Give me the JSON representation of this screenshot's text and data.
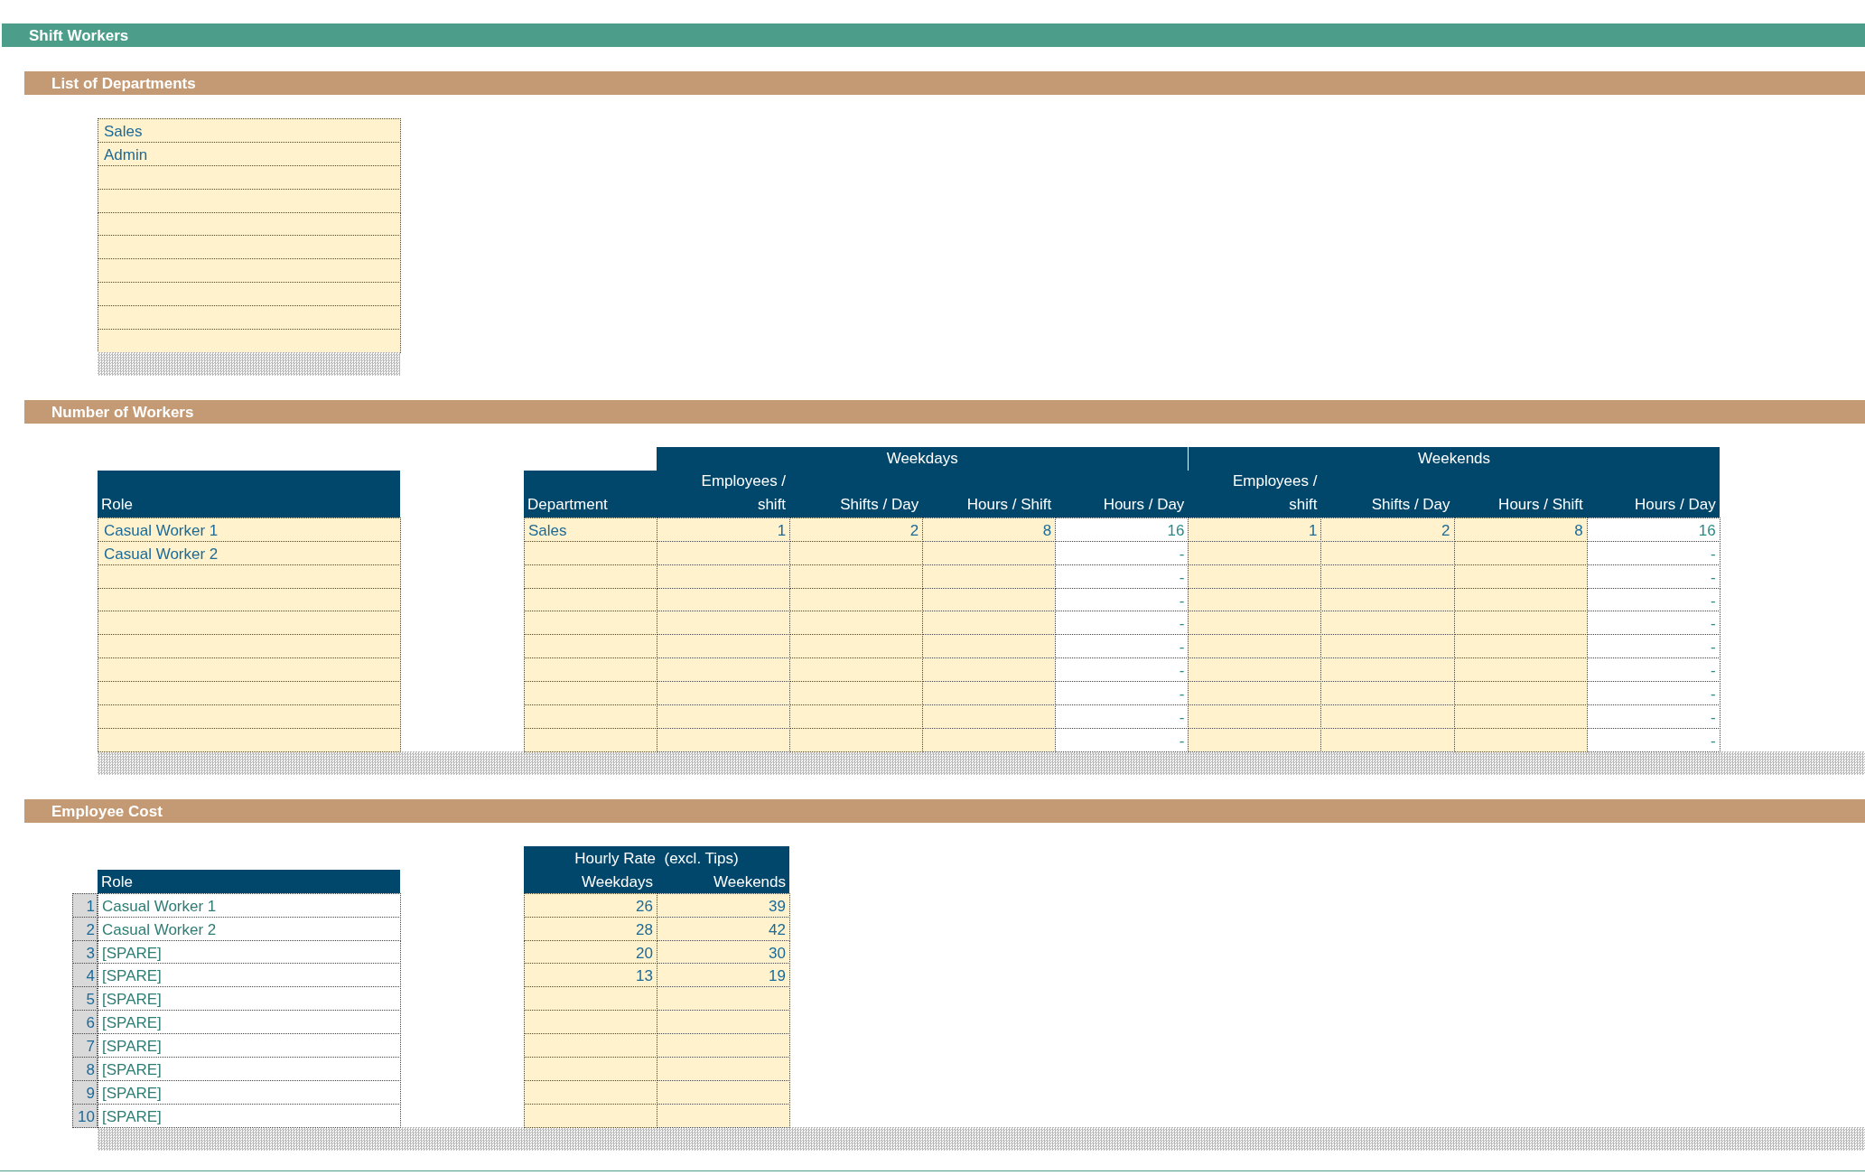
{
  "title": "Shift Workers",
  "departments": {
    "heading": "List of Departments",
    "items": [
      "Sales",
      "Admin"
    ]
  },
  "workers": {
    "heading": "Number of Workers",
    "role_column": "Role",
    "roles": [
      "Casual Worker 1",
      "Casual Worker 2"
    ],
    "department_column": "Department",
    "groups": [
      {
        "label": "Weekdays",
        "columns": [
          {
            "label": "Employees / shift",
            "kind": "input"
          },
          {
            "label": "Shifts / Day",
            "kind": "input"
          },
          {
            "label": "Hours / Shift",
            "kind": "input"
          },
          {
            "label": "Hours / Day",
            "kind": "computed"
          }
        ]
      },
      {
        "label": "Weekends",
        "columns": [
          {
            "label": "Employees / shift",
            "kind": "input"
          },
          {
            "label": "Shifts / Day",
            "kind": "input"
          },
          {
            "label": "Hours / Shift",
            "kind": "input"
          },
          {
            "label": "Hours / Day",
            "kind": "computed"
          }
        ]
      }
    ],
    "rows": [
      {
        "department": "Sales",
        "weekdays": {
          "employees_per_shift": "1",
          "shifts_per_day": "2",
          "hours_per_shift": "8",
          "hours_per_day": "16"
        },
        "weekends": {
          "employees_per_shift": "1",
          "shifts_per_day": "2",
          "hours_per_shift": "8",
          "hours_per_day": "16"
        }
      },
      {
        "weekdays": {
          "hours_per_day": "-"
        },
        "weekends": {
          "hours_per_day": "-"
        }
      },
      {
        "weekdays": {
          "hours_per_day": "-"
        },
        "weekends": {
          "hours_per_day": "-"
        }
      },
      {
        "weekdays": {
          "hours_per_day": "-"
        },
        "weekends": {
          "hours_per_day": "-"
        }
      },
      {
        "weekdays": {
          "hours_per_day": "-"
        },
        "weekends": {
          "hours_per_day": "-"
        }
      },
      {
        "weekdays": {
          "hours_per_day": "-"
        },
        "weekends": {
          "hours_per_day": "-"
        }
      },
      {
        "weekdays": {
          "hours_per_day": "-"
        },
        "weekends": {
          "hours_per_day": "-"
        }
      },
      {
        "weekdays": {
          "hours_per_day": "-"
        },
        "weekends": {
          "hours_per_day": "-"
        }
      },
      {
        "weekdays": {
          "hours_per_day": "-"
        },
        "weekends": {
          "hours_per_day": "-"
        }
      },
      {
        "weekdays": {
          "hours_per_day": "-"
        },
        "weekends": {
          "hours_per_day": "-"
        }
      }
    ]
  },
  "cost": {
    "heading": "Employee Cost",
    "role_column": "Role",
    "rate_title": "Hourly Rate  (excl. Tips)",
    "rate_columns": [
      "Weekdays",
      "Weekends"
    ],
    "rows": [
      {
        "number": "1",
        "role": "Casual Worker 1",
        "rates": {
          "weekdays": "26",
          "weekends": "39"
        }
      },
      {
        "number": "2",
        "role": "Casual Worker 2",
        "rates": {
          "weekdays": "28",
          "weekends": "42"
        }
      },
      {
        "number": "3",
        "role": "[SPARE]",
        "rates": {
          "weekdays": "20",
          "weekends": "30"
        }
      },
      {
        "number": "4",
        "role": "[SPARE]",
        "rates": {
          "weekdays": "13",
          "weekends": "19"
        }
      },
      {
        "number": "5",
        "role": "[SPARE]"
      },
      {
        "number": "6",
        "role": "[SPARE]"
      },
      {
        "number": "7",
        "role": "[SPARE]"
      },
      {
        "number": "8",
        "role": "[SPARE]"
      },
      {
        "number": "9",
        "role": "[SPARE]"
      },
      {
        "number": "10",
        "role": "[SPARE]"
      }
    ]
  }
}
